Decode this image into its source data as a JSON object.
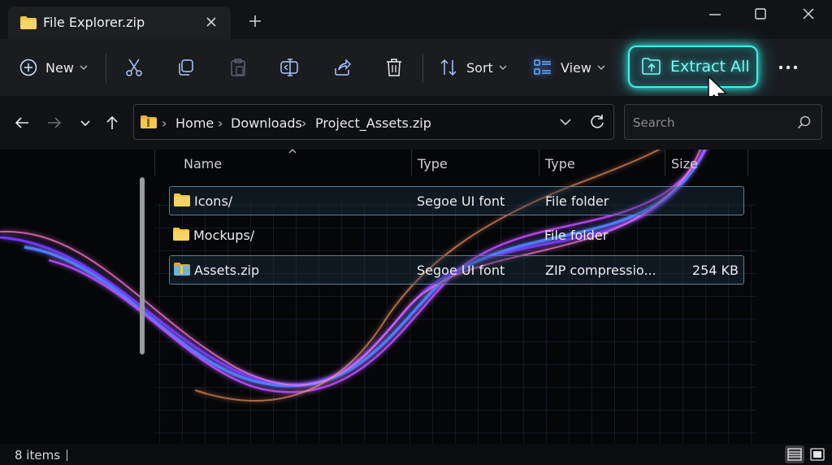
{
  "window": {
    "tab_title": "File Explorer.zip"
  },
  "toolbar": {
    "new_label": "New",
    "sort_label": "Sort",
    "view_label": "View",
    "extract_label": "Extract All"
  },
  "address": {
    "crumbs": [
      "Home",
      "Downloads",
      "Project_Assets.zip"
    ]
  },
  "search": {
    "placeholder": "Search"
  },
  "columns": [
    "Name",
    "Type",
    "Type",
    "Size"
  ],
  "files": [
    {
      "name": "Icons/",
      "type": "Segoe UI font",
      "kind": "File folder",
      "size": ""
    },
    {
      "name": "Mockups/",
      "type": "",
      "kind": "File folder",
      "size": ""
    },
    {
      "name": "Assets.zip",
      "type": "Segoe UI font",
      "kind": "ZIP compressio...",
      "size": "254 KB"
    }
  ],
  "status": {
    "items": "8 items"
  },
  "colors": {
    "accent_glow": "#3ff2e8",
    "folder": "#f4c542",
    "background": "#050608"
  }
}
